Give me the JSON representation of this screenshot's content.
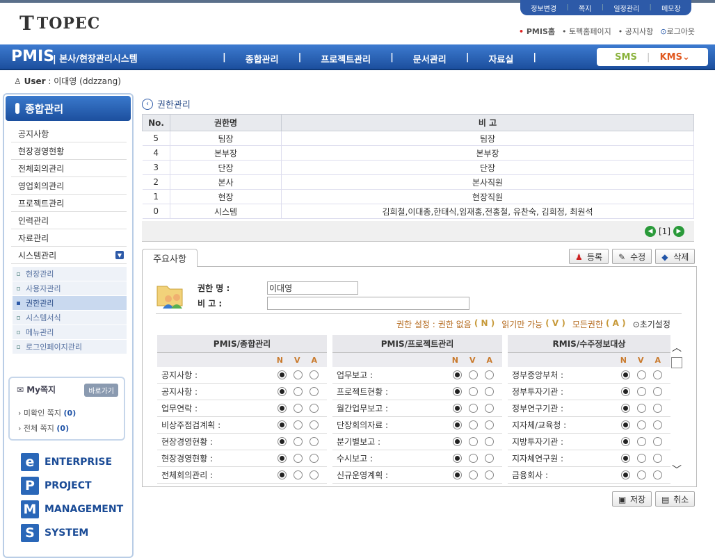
{
  "util_nav": [
    "정보변경",
    "쪽지",
    "일정관리",
    "메모장"
  ],
  "brand": {
    "mark": "T",
    "word": "TOPEC"
  },
  "top_links": [
    {
      "label": "PMIS홈",
      "style": "red"
    },
    {
      "label": "토펙홈페이지",
      "style": "normal"
    },
    {
      "label": "공지사항",
      "style": "normal"
    },
    {
      "label": "로그아웃",
      "style": "blue"
    }
  ],
  "gnb": {
    "pmis": "PMIS",
    "system_name": "본사/현장관리시스템",
    "menu": [
      "종합관리",
      "프로젝트관리",
      "문서관리",
      "자료실"
    ],
    "sms": "SMS",
    "kms": "KMS"
  },
  "user": {
    "label": "User",
    "value": "이대영 (ddzzang)"
  },
  "sidebar": {
    "title": "종합관리",
    "items": [
      "공지사항",
      "현장경영현황",
      "전체회의관리",
      "영업회의관리",
      "프로젝트관리",
      "인력관리",
      "자료관리",
      "시스템관리"
    ],
    "sub_items": [
      "현장관리",
      "사용자관리",
      "권한관리",
      "시스템서식",
      "메뉴관리",
      "로그인페이지관리"
    ],
    "active_sub": "권한관리"
  },
  "my_jjokji": {
    "title": "My쪽지",
    "go": "바로가기",
    "unread_label": "미확인 쪽지",
    "unread_count": "(0)",
    "all_label": "전체 쪽지",
    "all_count": "(0)"
  },
  "brand_menu": [
    {
      "letter": "e",
      "word": "ENTERPRISE"
    },
    {
      "letter": "P",
      "word": "PROJECT"
    },
    {
      "letter": "M",
      "word": "MANAGEMENT"
    },
    {
      "letter": "S",
      "word": "SYSTEM"
    }
  ],
  "breadcrumb": "권한관리",
  "grid": {
    "headers": [
      "No.",
      "권한명",
      "비    고"
    ],
    "rows": [
      [
        "5",
        "팀장",
        "팀장"
      ],
      [
        "4",
        "본부장",
        "본부장"
      ],
      [
        "3",
        "단장",
        "단장"
      ],
      [
        "2",
        "본사",
        "본사직원"
      ],
      [
        "1",
        "현장",
        "현장직원"
      ],
      [
        "0",
        "시스템",
        "김희철,이대종,한태식,임재홍,전홍철, 유찬숙, 김희정, 최원석"
      ]
    ],
    "page": "[1]"
  },
  "tab": "주요사항",
  "actions": {
    "register": "등록",
    "edit": "수정",
    "delete": "삭제"
  },
  "form": {
    "name_label": "권한 명 :",
    "name_value": "이대영",
    "note_label": "비    고 :",
    "note_value": ""
  },
  "legend": {
    "prefix": "권한 설정 :",
    "none": "권한 없음",
    "none_key": "( N )",
    "read": "읽기만 가능",
    "read_key": "( V )",
    "all": "모든권한",
    "all_key": "( A )",
    "reset": "초기설정"
  },
  "perm_cols": [
    "N",
    "V",
    "A"
  ],
  "perm_groups": [
    {
      "title": "PMIS/종합관리",
      "rows": [
        "공지사항 :",
        "공지사항 :",
        "업무연락 :",
        "비상주점검계획 :",
        "현장경영현황 :",
        "현장경영현황 :",
        "전체회의관리 :"
      ]
    },
    {
      "title": "PMIS/프로젝트관리",
      "rows": [
        "업무보고 :",
        "프로젝트현황 :",
        "월간업무보고 :",
        "단장회의자료 :",
        "분기별보고 :",
        "수시보고 :",
        "신규운영계획 :"
      ]
    },
    {
      "title": "RMIS/수주정보대상",
      "rows": [
        "정부중앙부처 :",
        "정부투자기관 :",
        "정부연구기관 :",
        "지자체/교육청 :",
        "지방투자기관 :",
        "지자체연구원 :",
        "금융회사 :"
      ]
    }
  ],
  "bottom": {
    "save": "저장",
    "cancel": "취소"
  }
}
